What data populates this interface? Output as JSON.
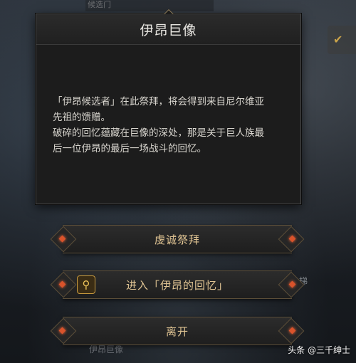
{
  "background": {
    "top_strip_text": "候选门",
    "side_text": "梯",
    "bottom_text": "伊昂巨像",
    "check_icon": "checkmark-icon"
  },
  "dialog": {
    "title": "伊昂巨像",
    "body_lines": [
      "「伊昂候选者」在此祭拜，将会得到来自尼尔维亚",
      "先祖的馈赠。",
      "破碎的回忆蕴藏在巨像的深处，那是关于巨人族最",
      "后一位伊昂的最后一场战斗的回忆。"
    ]
  },
  "buttons": {
    "worship": "虔诚祭拜",
    "enter_memory": "进入「伊昂的回忆」",
    "enter_memory_icon": "search-icon",
    "leave": "离开"
  },
  "watermark": "头条 @三千绅士",
  "colors": {
    "accent": "#e0c493",
    "ruby": "#d9532b"
  }
}
